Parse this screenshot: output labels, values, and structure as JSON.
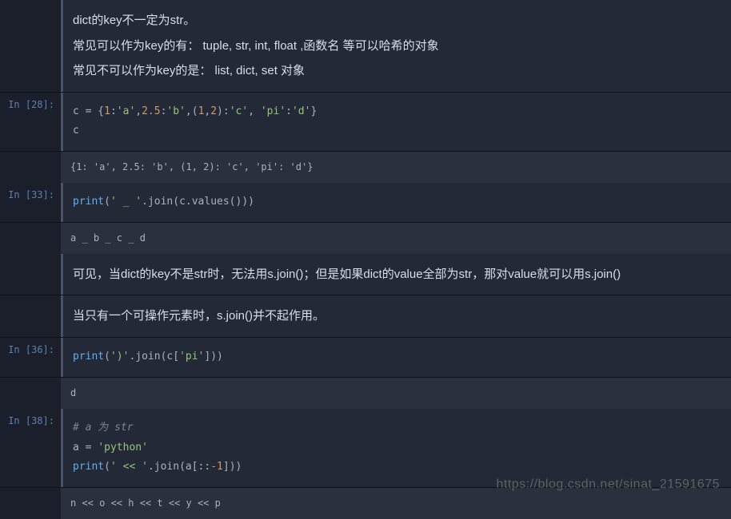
{
  "cells": {
    "md1": {
      "line1": "dict的key不一定为str。",
      "line2": "常见可以作为key的有：  tuple, str, int, float ,函数名 等可以哈希的对象",
      "line3": "常见不可以作为key的是：  list, dict, set 对象"
    },
    "in28": {
      "prompt": "In [28]:",
      "code_tokens": {
        "t1": "c = {",
        "n1": "1",
        "t2": ":",
        "s1": "'a'",
        "t3": ",",
        "n2": "2.5",
        "t4": ":",
        "s2": "'b'",
        "t5": ",(",
        "n3": "1",
        "t6": ",",
        "n4": "2",
        "t7": "):",
        "s3": "'c'",
        "t8": ", ",
        "s4": "'pi'",
        "t9": ":",
        "s5": "'d'",
        "t10": "}"
      },
      "line2": "c",
      "output": "{1: 'a', 2.5: 'b', (1, 2): 'c', 'pi': 'd'}"
    },
    "in33": {
      "prompt": "In [33]:",
      "code_tokens": {
        "fn": "print",
        "t1": "(",
        "s1": "' _ '",
        "t2": ".join(c.values()))"
      },
      "output": "a _ b _ c _ d"
    },
    "md2": {
      "text": "可见，当dict的key不是str时，无法用s.join()；但是如果dict的value全部为str，那对value就可以用s.join()"
    },
    "md3": {
      "text": "当只有一个可操作元素时，s.join()并不起作用。"
    },
    "in36": {
      "prompt": "In [36]:",
      "code_tokens": {
        "fn": "print",
        "t1": "(",
        "s1": "')'",
        "t2": ".join(c[",
        "s2": "'pi'",
        "t3": "]))"
      },
      "output": "d"
    },
    "in38": {
      "prompt": "In [38]:",
      "comment": "# a 为 str",
      "line2": {
        "t1": "a = ",
        "s1": "'python'"
      },
      "line3": {
        "fn": "print",
        "t1": "(",
        "s1": "' << '",
        "t2": ".join(a[::",
        "n1": "-1",
        "t3": "]))"
      },
      "output": "n << o << h << t << y << p"
    }
  },
  "watermark": "https://blog.csdn.net/sinat_21591675"
}
